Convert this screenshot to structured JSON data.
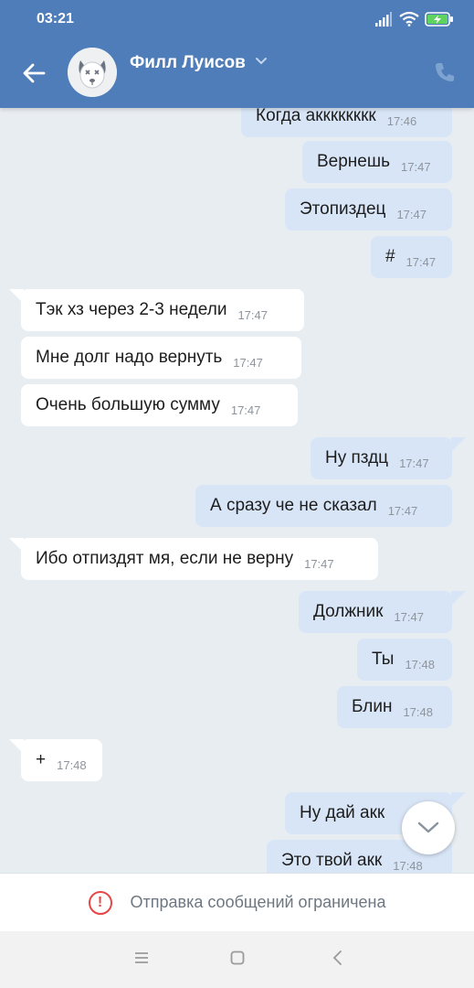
{
  "status_bar": {
    "time": "03:21",
    "icons": [
      "signal-icon",
      "wifi-icon",
      "battery-charging-icon"
    ]
  },
  "header": {
    "contact_name": "Филл Луисов",
    "avatar": "dog-avatar-icon",
    "back_icon": "arrow-left-icon",
    "call_icon": "phone-icon",
    "bg_color": "#4e7db9"
  },
  "messages": [
    {
      "dir": "out",
      "text": "Когда акккккккк",
      "time": "17:46"
    },
    {
      "dir": "out",
      "text": "Вернешь",
      "time": "17:47"
    },
    {
      "dir": "out",
      "text": "Этопиздец",
      "time": "17:47"
    },
    {
      "dir": "out",
      "text": "#",
      "time": "17:47"
    },
    {
      "dir": "in",
      "text": "Тэк хз через 2-3 недели",
      "time": "17:47"
    },
    {
      "dir": "in",
      "text": "Мне долг надо вернуть",
      "time": "17:47"
    },
    {
      "dir": "in",
      "text": "Очень большую сумму",
      "time": "17:47"
    },
    {
      "dir": "out",
      "text": "Ну пздц",
      "time": "17:47"
    },
    {
      "dir": "out",
      "text": "А сразу че не сказал",
      "time": "17:47"
    },
    {
      "dir": "in",
      "text": "Ибо отпиздят мя, если не верну",
      "time": "17:47"
    },
    {
      "dir": "out",
      "text": "Должник",
      "time": "17:47"
    },
    {
      "dir": "out",
      "text": "Ты",
      "time": "17:48"
    },
    {
      "dir": "out",
      "text": "Блин",
      "time": "17:48"
    },
    {
      "dir": "in",
      "text": "+",
      "time": "17:48"
    },
    {
      "dir": "out",
      "text": "Ну дай акк",
      "time": ""
    },
    {
      "dir": "out",
      "text": "Это твой акк",
      "time": "17:48"
    }
  ],
  "scroll_down_icon": "chevron-down-icon",
  "restriction": {
    "icon": "alert-circle-icon",
    "text": "Отправка сообщений ограничена",
    "icon_color": "#e64646"
  },
  "navbar": {
    "icons": [
      "menu-icon",
      "home-square-icon",
      "back-chevron-icon"
    ]
  }
}
